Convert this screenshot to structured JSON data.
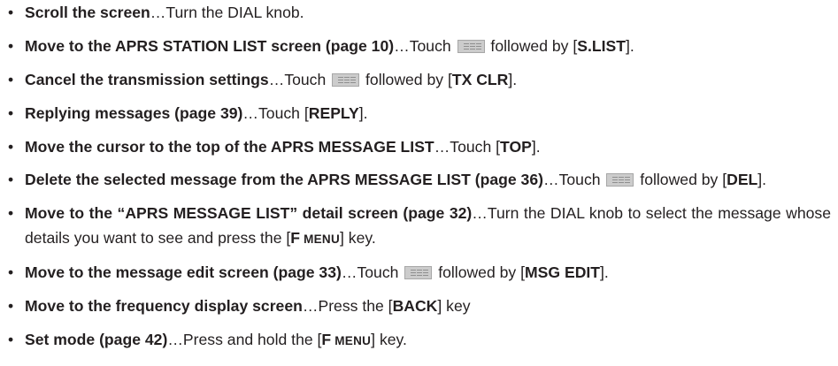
{
  "bullet": "•",
  "items": [
    {
      "b1": "Scroll the screen",
      "t1": "…Turn the DIAL knob."
    },
    {
      "b1": "Move to the APRS STATION LIST screen (page 10)",
      "t1": "…Touch ",
      "t2": " followed by [",
      "b2": "S.LIST",
      "t3": "]."
    },
    {
      "b1": "Cancel the transmission settings",
      "t1": "…Touch ",
      "t2": " followed by [",
      "b2": "TX CLR",
      "t3": "]."
    },
    {
      "b1": "Replying messages (page 39)",
      "t1": "…Touch [",
      "b2": "REPLY",
      "t3": "]."
    },
    {
      "b1": "Move the cursor to the top of the APRS MESSAGE LIST",
      "t1": "…Touch [",
      "b2": "TOP",
      "t3": "]."
    },
    {
      "b1": "Delete the selected message from the APRS MESSAGE LIST (page 36)",
      "t1": "…Touch",
      "t2": " followed by [",
      "b2": "DEL",
      "t3": "]."
    },
    {
      "b1": "Move to the “APRS MESSAGE LIST” detail screen (page 32)",
      "t1": "…Turn the DIAL knob to select the message whose details you want to see and press the [",
      "kf": "F",
      "km": " MENU",
      "t3": "] key."
    },
    {
      "b1": "Move to the message edit screen (page 33)",
      "t1": "…Touch ",
      "t2": " followed by [",
      "b2": "MSG EDIT",
      "t3": "]."
    },
    {
      "b1": "Move to the frequency display screen",
      "t1": "…Press the [",
      "b2": "BACK",
      "t3": "] key"
    },
    {
      "b1": "Set mode (page 42)",
      "t1": "…Press and hold the [",
      "kf": "F",
      "km": " MENU",
      "t3": "] key."
    }
  ],
  "icons": {
    "menu": "menu-grid-icon"
  }
}
